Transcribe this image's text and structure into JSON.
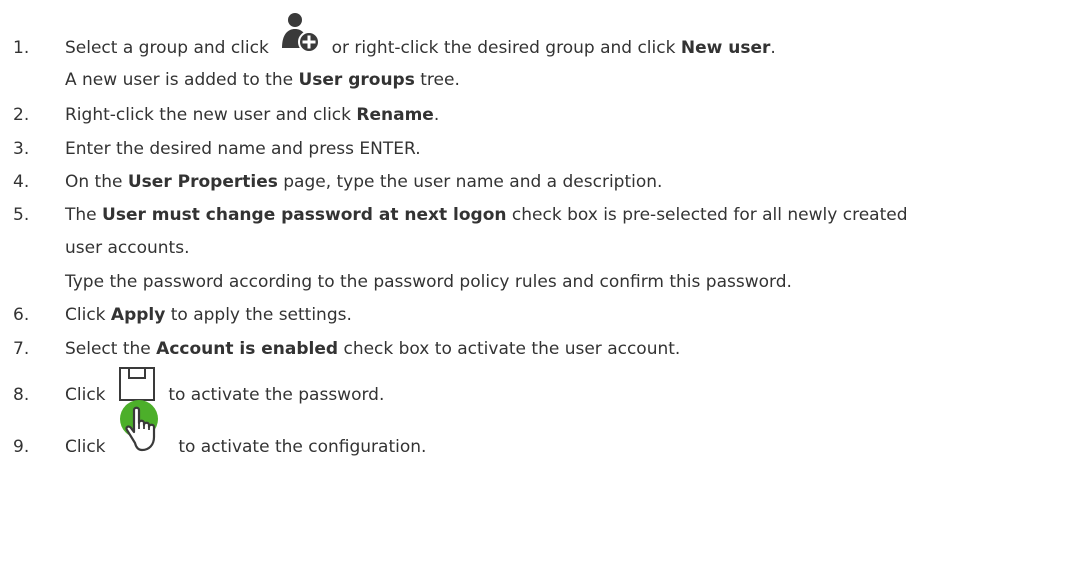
{
  "steps": [
    {
      "number": "1.",
      "lines": [
        {
          "parts": [
            {
              "text": "Select a group and click "
            },
            {
              "icon": "add-user-icon"
            },
            {
              "text": " or right-click the desired group and click "
            },
            {
              "text": "New user",
              "bold": true
            },
            {
              "text": "."
            }
          ]
        },
        {
          "parts": [
            {
              "text": "A new user is added to the "
            },
            {
              "text": "User groups",
              "bold": true
            },
            {
              "text": " tree."
            }
          ]
        }
      ]
    },
    {
      "number": "2.",
      "lines": [
        {
          "parts": [
            {
              "text": "Right-click the new user and click "
            },
            {
              "text": "Rename",
              "bold": true
            },
            {
              "text": "."
            }
          ]
        }
      ]
    },
    {
      "number": "3.",
      "lines": [
        {
          "parts": [
            {
              "text": "Enter the desired name and press ENTER."
            }
          ]
        }
      ]
    },
    {
      "number": "4.",
      "lines": [
        {
          "parts": [
            {
              "text": "On the "
            },
            {
              "text": "User Properties",
              "bold": true
            },
            {
              "text": " page, type the user name and a description."
            }
          ]
        }
      ]
    },
    {
      "number": "5.",
      "lines": [
        {
          "parts": [
            {
              "text": "The "
            },
            {
              "text": "User must change password at next logon",
              "bold": true
            },
            {
              "text": " check box is pre-selected for all newly created"
            }
          ]
        },
        {
          "parts": [
            {
              "text": "user accounts."
            }
          ]
        },
        {
          "parts": [
            {
              "text": "Type the password according to the password policy rules and confirm this password."
            }
          ]
        }
      ]
    },
    {
      "number": "6.",
      "lines": [
        {
          "parts": [
            {
              "text": "Click "
            },
            {
              "text": "Apply",
              "bold": true
            },
            {
              "text": " to apply the settings."
            }
          ]
        }
      ]
    },
    {
      "number": "7.",
      "lines": [
        {
          "parts": [
            {
              "text": "Select the "
            },
            {
              "text": "Account is enabled",
              "bold": true
            },
            {
              "text": " check box to activate the user account."
            }
          ]
        }
      ]
    },
    {
      "number": "8.",
      "lines": [
        {
          "parts": [
            {
              "text": "Click "
            },
            {
              "icon": "save-icon"
            },
            {
              "text": " to activate the password."
            }
          ]
        }
      ]
    },
    {
      "number": "9.",
      "lines": [
        {
          "parts": [
            {
              "text": "Click "
            },
            {
              "icon": "activate-configuration-icon"
            },
            {
              "text": " to activate the configuration."
            }
          ]
        }
      ]
    }
  ],
  "colors": {
    "text": "#333333",
    "icon_dark": "#3a3a3a",
    "icon_green": "#4caf2a"
  }
}
